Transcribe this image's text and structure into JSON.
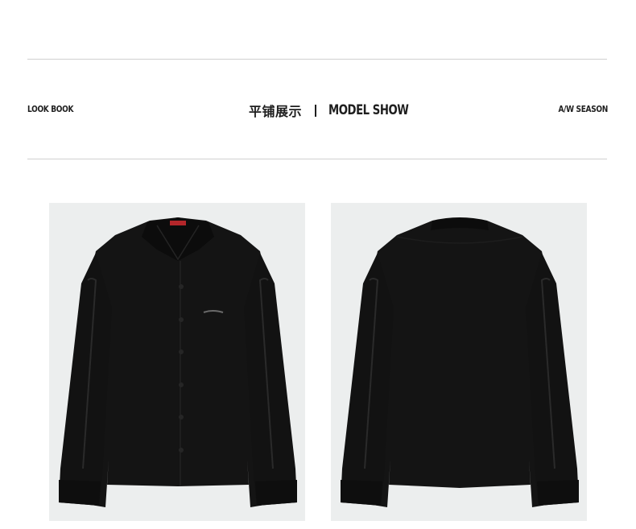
{
  "header": {
    "left_tag": "LOOK BOOK",
    "title_cn": "平铺展示",
    "title_en": "MODEL SHOW",
    "right_tag": "A/W SEASON"
  },
  "images": [
    {
      "name": "shirt-front-photo",
      "description_icon": "black-shirt-front"
    },
    {
      "name": "shirt-back-photo",
      "description_icon": "black-shirt-back"
    }
  ],
  "colors": {
    "background": "#ffffff",
    "rule": "#d0d0d0",
    "text": "#1e1e1e",
    "photo_bg": "#eceeee",
    "shirt": "#141414",
    "label_red": "#b3262a"
  }
}
